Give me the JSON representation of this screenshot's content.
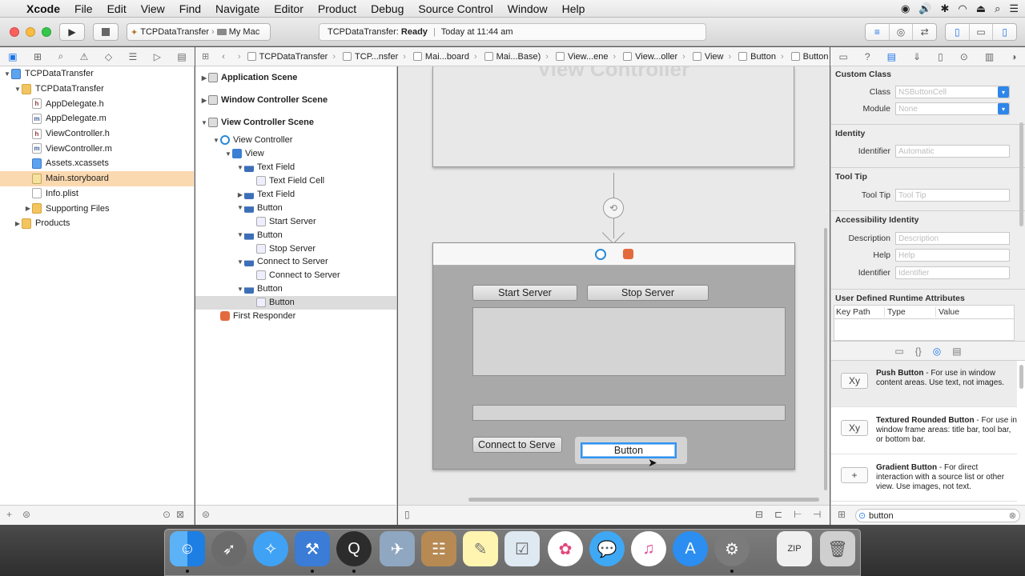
{
  "menubar": {
    "apple": "",
    "app": "Xcode",
    "items": [
      "File",
      "Edit",
      "View",
      "Find",
      "Navigate",
      "Editor",
      "Product",
      "Debug",
      "Source Control",
      "Window",
      "Help"
    ]
  },
  "toolbar": {
    "scheme_target": "TCPDataTransfer",
    "scheme_device": "My Mac",
    "activity_project": "TCPDataTransfer:",
    "activity_status": "Ready",
    "activity_time": "Today at 11:44 am"
  },
  "navigator": {
    "items": [
      {
        "label": "TCPDataTransfer",
        "indent": 0,
        "kind": "assets",
        "tri": "▼"
      },
      {
        "label": "TCPDataTransfer",
        "indent": 1,
        "kind": "folder",
        "tri": "▼"
      },
      {
        "label": "AppDelegate.h",
        "indent": 2,
        "kind": "h",
        "tri": ""
      },
      {
        "label": "AppDelegate.m",
        "indent": 2,
        "kind": "m",
        "tri": ""
      },
      {
        "label": "ViewController.h",
        "indent": 2,
        "kind": "h",
        "tri": ""
      },
      {
        "label": "ViewController.m",
        "indent": 2,
        "kind": "m",
        "tri": ""
      },
      {
        "label": "Assets.xcassets",
        "indent": 2,
        "kind": "assets",
        "tri": ""
      },
      {
        "label": "Main.storyboard",
        "indent": 2,
        "kind": "sb",
        "tri": "",
        "selected": true
      },
      {
        "label": "Info.plist",
        "indent": 2,
        "kind": "plist",
        "tri": ""
      },
      {
        "label": "Supporting Files",
        "indent": 2,
        "kind": "folder",
        "tri": "▶"
      },
      {
        "label": "Products",
        "indent": 1,
        "kind": "folder",
        "tri": "▶"
      }
    ]
  },
  "jumpbar": {
    "crumbs": [
      "TCPDataTransfer",
      "TCP...nsfer",
      "Mai...board",
      "Mai...Base)",
      "View...ene",
      "View...oller",
      "View",
      "Button",
      "Button"
    ]
  },
  "outline": {
    "items": [
      {
        "label": "Application Scene",
        "indent": 0,
        "kind": "scene",
        "tri": "▶",
        "scene": true
      },
      {
        "label": "Window Controller Scene",
        "indent": 0,
        "kind": "scene",
        "tri": "▶",
        "scene": true
      },
      {
        "label": "View Controller Scene",
        "indent": 0,
        "kind": "scene",
        "tri": "▼",
        "scene": true
      },
      {
        "label": "View Controller",
        "indent": 1,
        "kind": "vc",
        "tri": "▼"
      },
      {
        "label": "View",
        "indent": 2,
        "kind": "view",
        "tri": "▼"
      },
      {
        "label": "Text Field",
        "indent": 3,
        "kind": "ctl",
        "tri": "▼"
      },
      {
        "label": "Text Field Cell",
        "indent": 4,
        "kind": "cell",
        "tri": ""
      },
      {
        "label": "Text Field",
        "indent": 3,
        "kind": "ctl",
        "tri": "▶"
      },
      {
        "label": "Button",
        "indent": 3,
        "kind": "ctl",
        "tri": "▼"
      },
      {
        "label": "Start Server",
        "indent": 4,
        "kind": "cell",
        "tri": ""
      },
      {
        "label": "Button",
        "indent": 3,
        "kind": "ctl",
        "tri": "▼"
      },
      {
        "label": "Stop Server",
        "indent": 4,
        "kind": "cell",
        "tri": ""
      },
      {
        "label": "Connect to Server",
        "indent": 3,
        "kind": "ctl",
        "tri": "▼"
      },
      {
        "label": "Connect to Server",
        "indent": 4,
        "kind": "cell",
        "tri": ""
      },
      {
        "label": "Button",
        "indent": 3,
        "kind": "ctl",
        "tri": "▼"
      },
      {
        "label": "Button",
        "indent": 4,
        "kind": "cell",
        "tri": "",
        "selected": true
      },
      {
        "label": "First Responder",
        "indent": 1,
        "kind": "fr",
        "tri": ""
      }
    ]
  },
  "canvas": {
    "top_ghost": "View Controller",
    "start_button": "Start Server",
    "stop_button": "Stop Server",
    "connect_button": "Connect to Serve",
    "selected_button": "Button"
  },
  "inspector": {
    "custom_class_header": "Custom Class",
    "class_label": "Class",
    "class_placeholder": "NSButtonCell",
    "module_label": "Module",
    "module_placeholder": "None",
    "identity_header": "Identity",
    "identifier_label": "Identifier",
    "identifier_placeholder": "Automatic",
    "tooltip_header": "Tool Tip",
    "tooltip_label": "Tool Tip",
    "tooltip_placeholder": "Tool Tip",
    "accessibility_header": "Accessibility Identity",
    "description_label": "Description",
    "description_placeholder": "Description",
    "help_label": "Help",
    "help_placeholder": "Help",
    "acc_identifier_label": "Identifier",
    "acc_identifier_placeholder": "Identifier",
    "runtime_header": "User Defined Runtime Attributes",
    "col_keypath": "Key Path",
    "col_type": "Type",
    "col_value": "Value"
  },
  "library": {
    "items": [
      {
        "icon": "Xy",
        "name": "Push Button",
        "desc": " - For use in window content areas. Use text, not images.",
        "selected": true
      },
      {
        "icon": "Xy",
        "name": "Textured Rounded Button",
        "desc": " - For use in window frame areas: title bar, tool bar, or bottom bar."
      },
      {
        "icon": "+",
        "name": "Gradient Button",
        "desc": " - For direct interaction with a source list or other view. Use images, not text."
      }
    ],
    "search_value": "button"
  },
  "colors": {
    "accent": "#2f93f2",
    "selection_orange": "#fbd9b0"
  }
}
